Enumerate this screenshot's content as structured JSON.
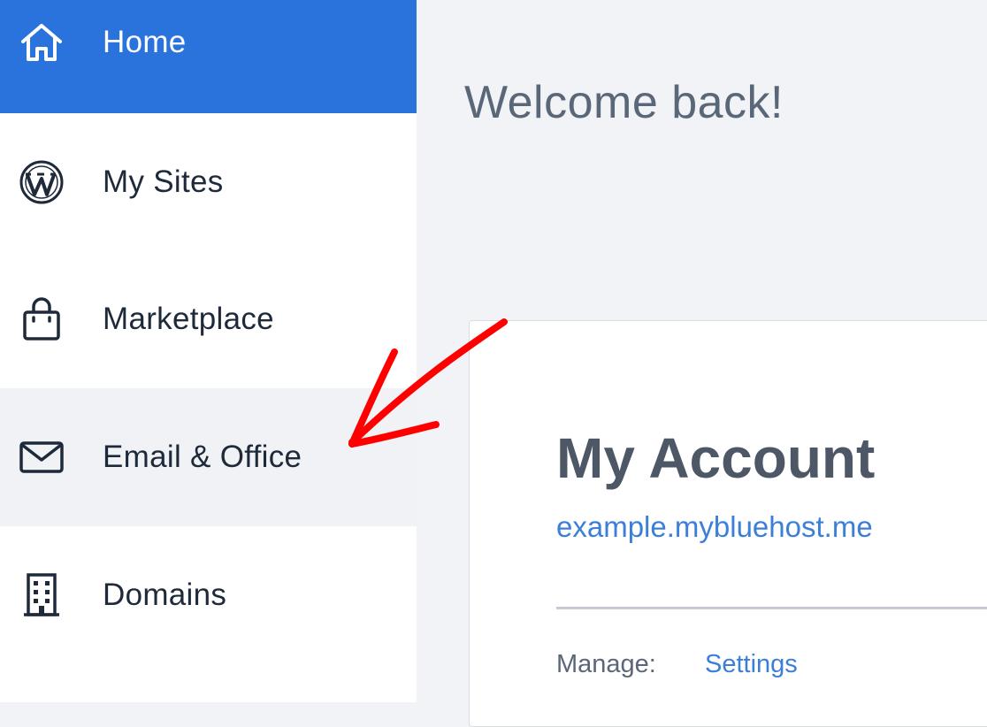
{
  "sidebar": {
    "items": [
      {
        "label": "Home",
        "icon": "home-icon",
        "active": true
      },
      {
        "label": "My Sites",
        "icon": "wordpress-icon"
      },
      {
        "label": "Marketplace",
        "icon": "shopping-bag-icon"
      },
      {
        "label": "Email & Office",
        "icon": "envelope-icon",
        "hovered": true
      },
      {
        "label": "Domains",
        "icon": "building-icon"
      }
    ]
  },
  "main": {
    "welcome": "Welcome back!",
    "account_card": {
      "title": "My Account",
      "domain": "example.mybluehost.me",
      "manage_label": "Manage:",
      "manage_link": "Settings"
    }
  },
  "annotation": {
    "type": "arrow",
    "color": "#ff0000",
    "points_to": "Email & Office"
  },
  "colors": {
    "accent": "#2b73dc",
    "link": "#3b7fd9",
    "text_dark": "#1e2a3a",
    "text_muted": "#5a6778",
    "background": "#f1f3f6"
  }
}
